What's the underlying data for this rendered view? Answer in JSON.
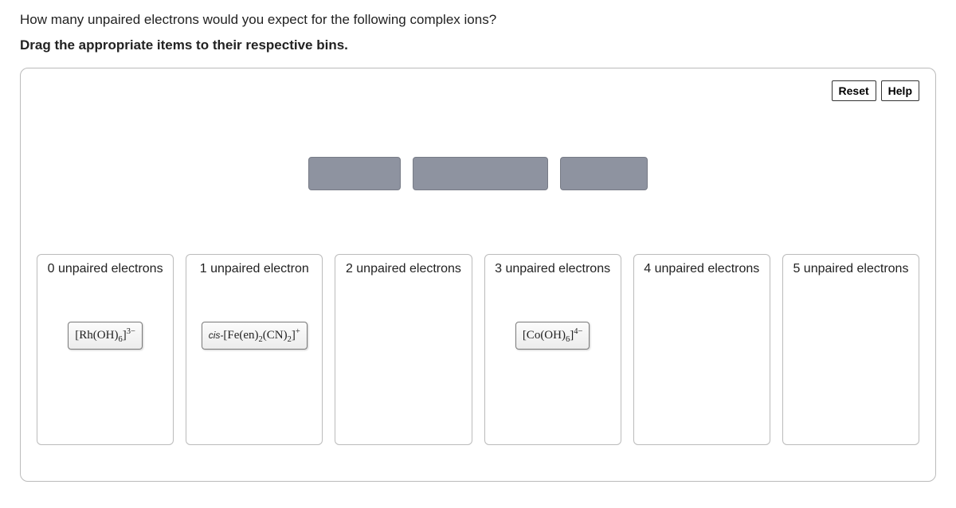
{
  "question": "How many unpaired electrons would you expect for the following complex ions?",
  "instruction": "Drag the appropriate items to their respective bins.",
  "controls": {
    "reset": "Reset",
    "help": "Help"
  },
  "bins": [
    {
      "title": "0 unpaired electrons"
    },
    {
      "title": "1 unpaired electron"
    },
    {
      "title": "2 unpaired electrons"
    },
    {
      "title": "3 unpaired electrons"
    },
    {
      "title": "4 unpaired electrons"
    },
    {
      "title": "5 unpaired electrons"
    }
  ],
  "chips": {
    "rh": {
      "formula_html": "[Rh(OH)<sub>6</sub>]<sup>3−</sup>"
    },
    "fe": {
      "prefix": "cis-",
      "formula_html": "[Fe(en)<sub>2</sub>(CN)<sub>2</sub>]<sup>+</sup>"
    },
    "co": {
      "formula_html": "[Co(OH)<sub>6</sub>]<sup>4−</sup>"
    }
  }
}
